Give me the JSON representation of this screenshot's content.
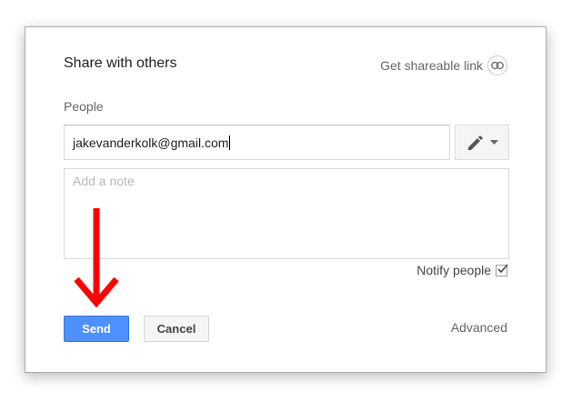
{
  "dialog": {
    "title": "Share with others",
    "shareable_link_label": "Get shareable link",
    "people_label": "People",
    "email_value": "jakevanderkolk@gmail.com",
    "note_placeholder": "Add a note",
    "notify_label": "Notify people",
    "notify_checked": true,
    "send_label": "Send",
    "cancel_label": "Cancel",
    "advanced_label": "Advanced"
  },
  "icons": {
    "link": "link-icon",
    "permission": "pencil-icon",
    "dropdown": "caret-down-icon",
    "checkbox": "checkmark-icon",
    "annotation": "red-arrow-down"
  },
  "colors": {
    "send_button": "#4d90fe",
    "annotation_arrow": "#ff0000"
  }
}
